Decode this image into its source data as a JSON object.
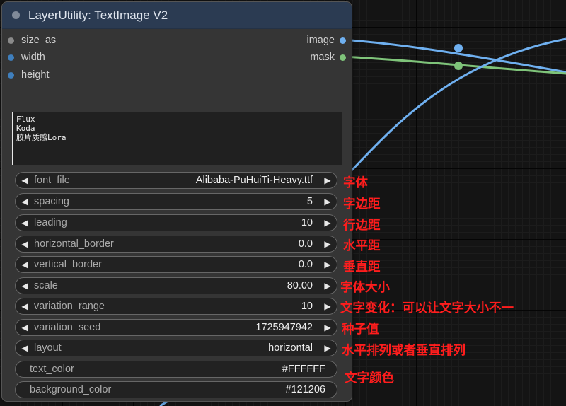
{
  "canvas": {
    "background_color": "#141414",
    "link_colors": {
      "image": "#6fb0f0",
      "mask": "#7fc47a"
    }
  },
  "node": {
    "title": "LayerUtility: TextImage V2",
    "header_color": "#2b3b52",
    "body_color": "#353535",
    "inputs": [
      {
        "name": "size_as",
        "dot_color": "#8a8a8a"
      },
      {
        "name": "width",
        "dot_color": "#3f7fbd"
      },
      {
        "name": "height",
        "dot_color": "#3f7fbd"
      }
    ],
    "outputs": [
      {
        "name": "image",
        "dot_color": "#6fb0f0"
      },
      {
        "name": "mask",
        "dot_color": "#7fc47a"
      }
    ],
    "text_lines": [
      "Flux",
      "Koda",
      "胶片质感Lora"
    ],
    "widgets": [
      {
        "name": "font_file",
        "value": "Alibaba-PuHuiTi-Heavy.ttf",
        "type": "combo"
      },
      {
        "name": "spacing",
        "value": "5",
        "type": "number"
      },
      {
        "name": "leading",
        "value": "10",
        "type": "number"
      },
      {
        "name": "horizontal_border",
        "value": "0.0",
        "type": "number"
      },
      {
        "name": "vertical_border",
        "value": "0.0",
        "type": "number"
      },
      {
        "name": "scale",
        "value": "80.00",
        "type": "number"
      },
      {
        "name": "variation_range",
        "value": "10",
        "type": "number"
      },
      {
        "name": "variation_seed",
        "value": "1725947942",
        "type": "number"
      },
      {
        "name": "layout",
        "value": "horizontal",
        "type": "combo"
      },
      {
        "name": "text_color",
        "value": "#FFFFFF",
        "type": "text"
      },
      {
        "name": "background_color",
        "value": "#121206",
        "type": "text"
      }
    ],
    "arrows": {
      "left": "◀",
      "right": "▶"
    }
  },
  "annotations": {
    "color": "#ff1d1d",
    "items": [
      "字体",
      "字边距",
      "行边距",
      "水平距",
      "垂直距",
      "字体大小",
      "文字变化：可以让文字大小不一",
      "种子值",
      "水平排列或者垂直排列",
      "文字颜色"
    ]
  }
}
